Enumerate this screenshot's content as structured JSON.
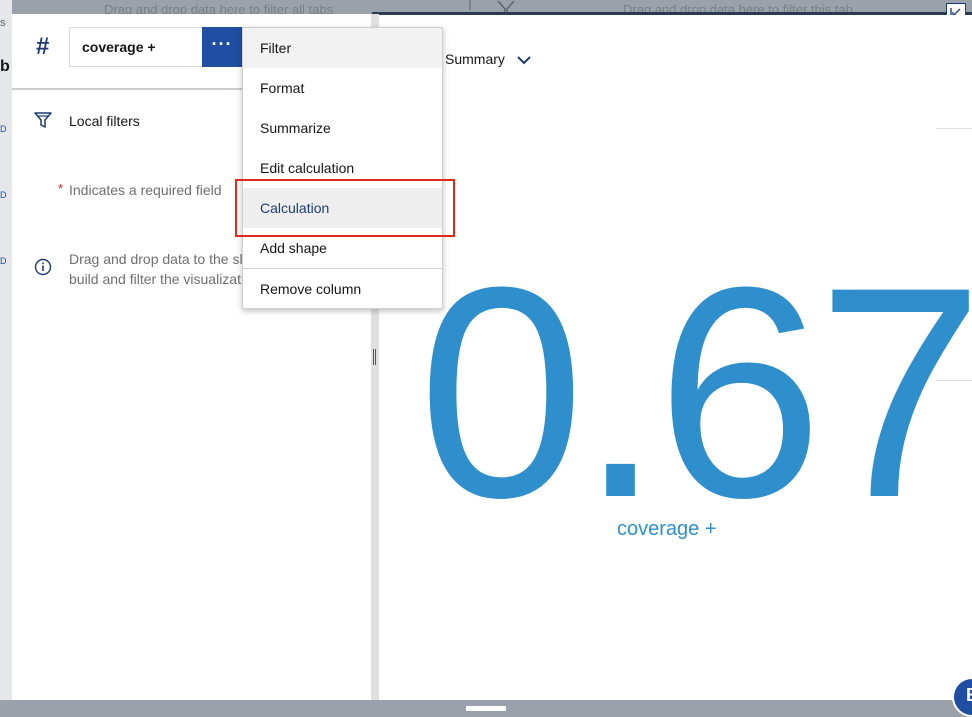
{
  "background": {
    "top_left_text": "Drag and drop data here to filter all tabs",
    "top_right_text": "Drag and drop data here to filter this tab",
    "left_glyphs": [
      "s",
      "b",
      "D",
      "D",
      "D"
    ]
  },
  "field": {
    "type_icon": "#",
    "label": "coverage +",
    "more_label": "···"
  },
  "left_panel": {
    "local_filters": "Local filters",
    "required_star": "*",
    "required_text": "Indicates a required field",
    "drag_text_line1": "Drag and drop data to the sl",
    "drag_text_line2": "build and filter the visualizati"
  },
  "menu": {
    "items": [
      {
        "label": "Filter"
      },
      {
        "label": "Format"
      },
      {
        "label": "Summarize"
      },
      {
        "label": "Edit calculation"
      },
      {
        "label": "Calculation"
      },
      {
        "label": "Add shape"
      },
      {
        "label": "Remove column"
      }
    ]
  },
  "visualization": {
    "summary_label": "Summary",
    "value": "0.67",
    "caption": "coverage +"
  },
  "floating_button": {
    "label": "B"
  },
  "colors": {
    "accent": "#1f4ea3",
    "value": "#2f8fcd",
    "highlight": "#e0281b"
  }
}
